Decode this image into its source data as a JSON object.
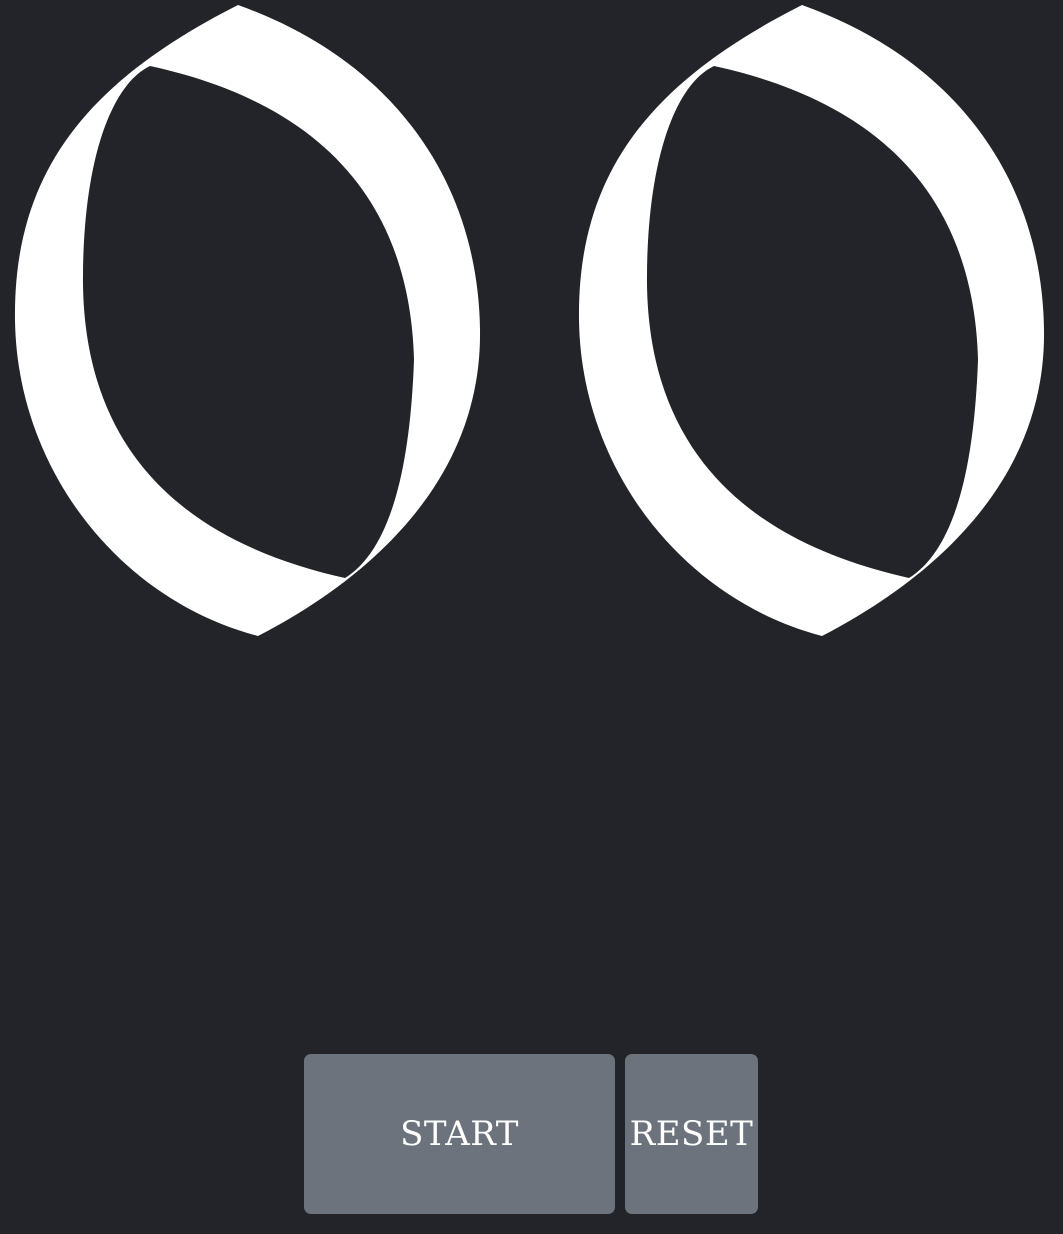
{
  "colors": {
    "background": "#222429",
    "eye": "#ffffff",
    "button": "#6c737c",
    "button_text": "#ffffff"
  },
  "eyes": [
    {
      "name": "left-eye"
    },
    {
      "name": "right-eye"
    }
  ],
  "controls": {
    "start_label": "START",
    "reset_label": "RESET"
  }
}
